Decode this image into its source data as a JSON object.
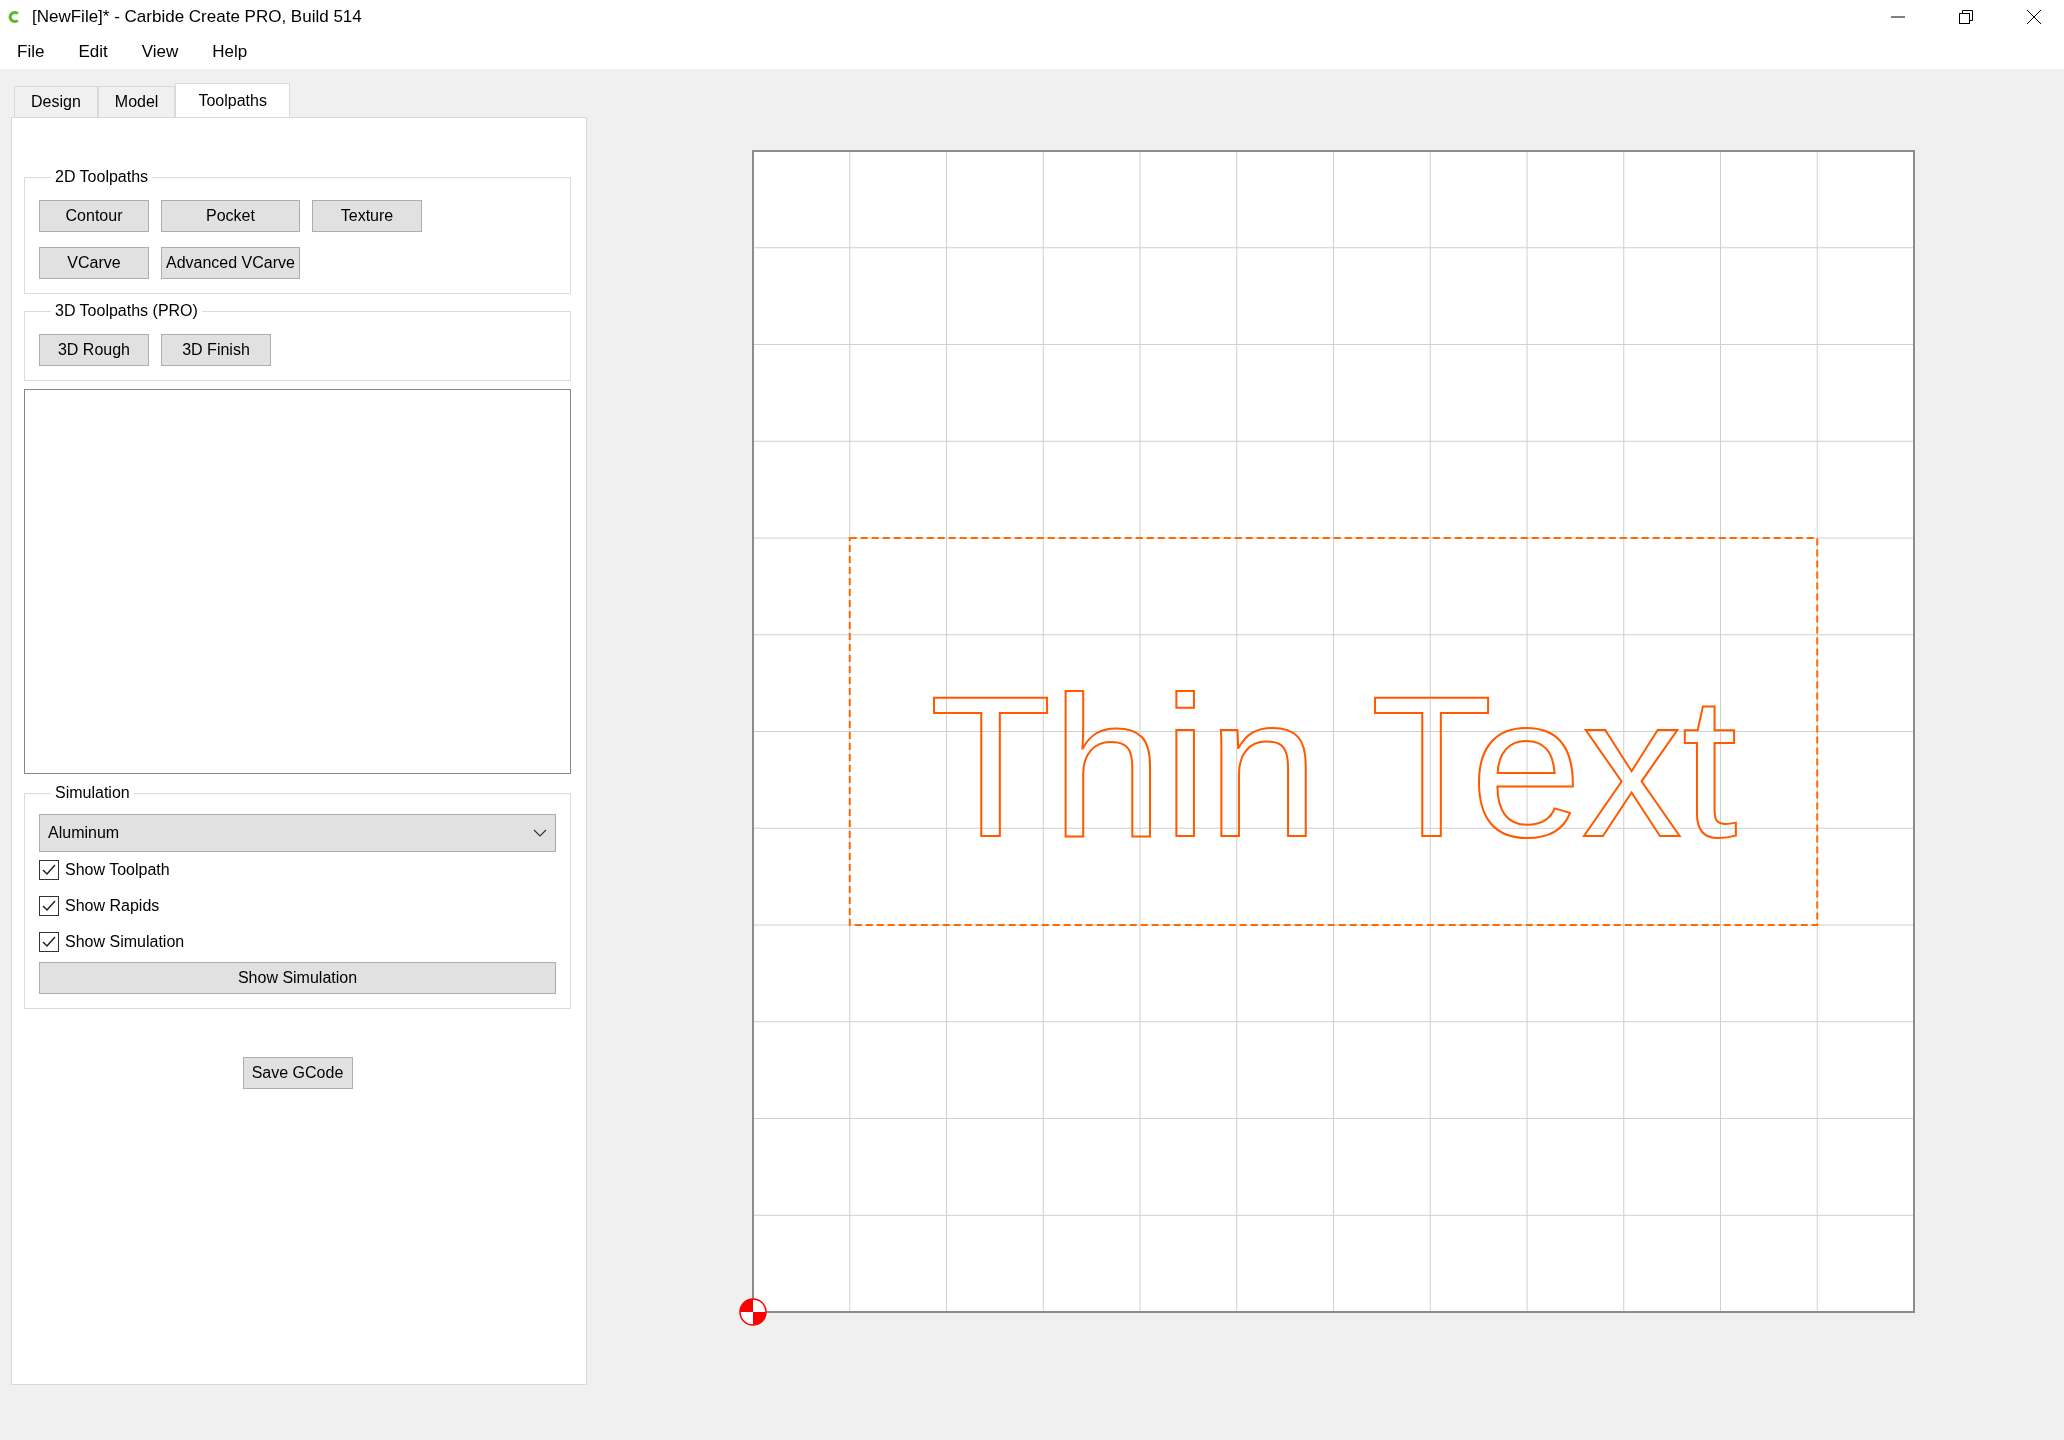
{
  "window": {
    "title": "[NewFile]* - Carbide Create PRO, Build 514"
  },
  "menu": [
    "File",
    "Edit",
    "View",
    "Help"
  ],
  "tabs": [
    {
      "label": "Design",
      "selected": false
    },
    {
      "label": "Model",
      "selected": false
    },
    {
      "label": "Toolpaths",
      "selected": true
    }
  ],
  "groups": [
    {
      "title": "2D Toolpaths",
      "buttons": [
        "Contour",
        "Pocket",
        "Texture",
        "VCarve",
        "Advanced VCarve"
      ]
    },
    {
      "title": "3D Toolpaths (PRO)",
      "buttons": [
        "3D Rough",
        "3D Finish"
      ]
    }
  ],
  "simulation": {
    "title": "Simulation",
    "material": "Aluminum",
    "checkboxes": [
      {
        "label": "Show Toolpath",
        "checked": true
      },
      {
        "label": "Show Rapids",
        "checked": true
      },
      {
        "label": "Show Simulation",
        "checked": true
      }
    ],
    "button": "Show Simulation"
  },
  "save_button": "Save GCode",
  "canvas": {
    "text": "Thin Text"
  }
}
